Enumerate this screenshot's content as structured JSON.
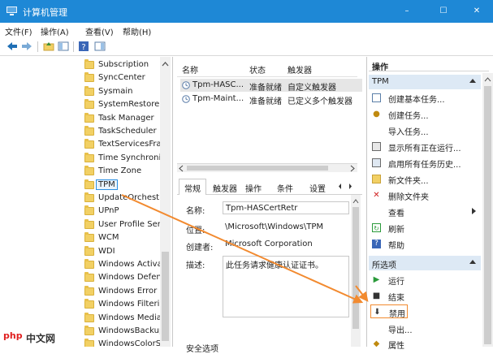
{
  "window": {
    "title": "计算机管理",
    "minimize": "–",
    "maximize": "☐",
    "close": "✕"
  },
  "menu": [
    "文件(F)",
    "操作(A)",
    "查看(V)",
    "帮助(H)"
  ],
  "tree": {
    "items": [
      "Subscription",
      "SyncCenter",
      "Sysmain",
      "SystemRestore",
      "Task Manager",
      "TaskScheduler",
      "TextServicesFra",
      "Time Synchroni",
      "Time Zone",
      "TPM",
      "UpdateOrchestr",
      "UPnP",
      "User Profile Ser",
      "WCM",
      "WDI",
      "Windows Activa",
      "Windows Defen",
      "Windows Error",
      "Windows Filterir",
      "Windows Media",
      "WindowsBackup",
      "WindowsColorS"
    ],
    "selected": "TPM"
  },
  "task_list": {
    "columns": [
      "名称",
      "状态",
      "触发器"
    ],
    "rows": [
      {
        "name": "Tpm-HASC...",
        "status": "准备就绪",
        "trigger": "自定义触发器"
      },
      {
        "name": "Tpm-Maint...",
        "status": "准备就绪",
        "trigger": "已定义多个触发器"
      }
    ]
  },
  "tabs": [
    "常规",
    "触发器",
    "操作",
    "条件",
    "设置"
  ],
  "detail": {
    "name_label": "名称:",
    "name_value": "Tpm-HASCertRetr",
    "location_label": "位置:",
    "location_value": "\\Microsoft\\Windows\\TPM",
    "author_label": "创建者:",
    "author_value": "Microsoft Corporation",
    "description_label": "描述:",
    "description_value": "此任务请求健康认证证书。",
    "security_label": "安全选项"
  },
  "actions": {
    "header": "操作",
    "section_tpm": "TPM",
    "tpm_items": [
      "创建基本任务...",
      "创建任务...",
      "导入任务...",
      "显示所有正在运行...",
      "启用所有任务历史...",
      "新文件夹...",
      "删除文件夹",
      "查看",
      "刷新",
      "帮助"
    ],
    "section_selected": "所选项",
    "selected_items": [
      "运行",
      "结束",
      "禁用",
      "导出...",
      "属性"
    ]
  },
  "watermark": {
    "logo": "php",
    "text": "中文网"
  },
  "colors": {
    "titlebar": "#1e88d6",
    "highlight": "#f28a2f",
    "selection": "#e6e6e6",
    "section_bg": "#dde9f5"
  }
}
